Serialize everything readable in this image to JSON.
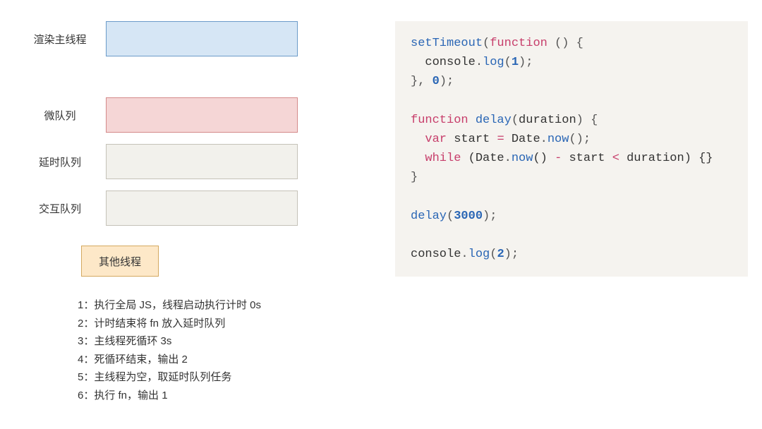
{
  "queues": {
    "main_thread": "渲染主线程",
    "microtask": "微队列",
    "delay_queue": "延时队列",
    "interaction_queue": "交互队列"
  },
  "other_threads": "其他线程",
  "steps": [
    "1：执行全局 JS，线程启动执行计时 0s",
    "2：计时结束将 fn 放入延时队列",
    "3：主线程死循环 3s",
    "4：死循环结束，输出 2",
    "5：主线程为空，取延时队列任务",
    "6：执行 fn，输出 1"
  ],
  "code": {
    "l1_p1": "setTimeout",
    "l1_p2": "(",
    "l1_p3": "function",
    "l1_p4": " () {",
    "l2_p1": "  console",
    "l2_p2": ".",
    "l2_p3": "log",
    "l2_p4": "(",
    "l2_p5": "1",
    "l2_p6": ");",
    "l3_p1": "}, ",
    "l3_p2": "0",
    "l3_p3": ");",
    "l5_p1": "function",
    "l5_p2": " ",
    "l5_p3": "delay",
    "l5_p4": "(",
    "l5_p5": "duration",
    "l5_p6": ") {",
    "l6_p1": "  ",
    "l6_p2": "var",
    "l6_p3": " start ",
    "l6_p4": "=",
    "l6_p5": " Date",
    "l6_p6": ".",
    "l6_p7": "now",
    "l6_p8": "();",
    "l7_p1": "  ",
    "l7_p2": "while",
    "l7_p3": " (Date",
    "l7_p4": ".",
    "l7_p5": "now",
    "l7_p6": "() ",
    "l7_p7": "-",
    "l7_p8": " start ",
    "l7_p9": "<",
    "l7_p10": " duration) {}",
    "l8_p1": "}",
    "l10_p1": "delay",
    "l10_p2": "(",
    "l10_p3": "3000",
    "l10_p4": ");",
    "l12_p1": "console",
    "l12_p2": ".",
    "l12_p3": "log",
    "l12_p4": "(",
    "l12_p5": "2",
    "l12_p6": ");"
  }
}
